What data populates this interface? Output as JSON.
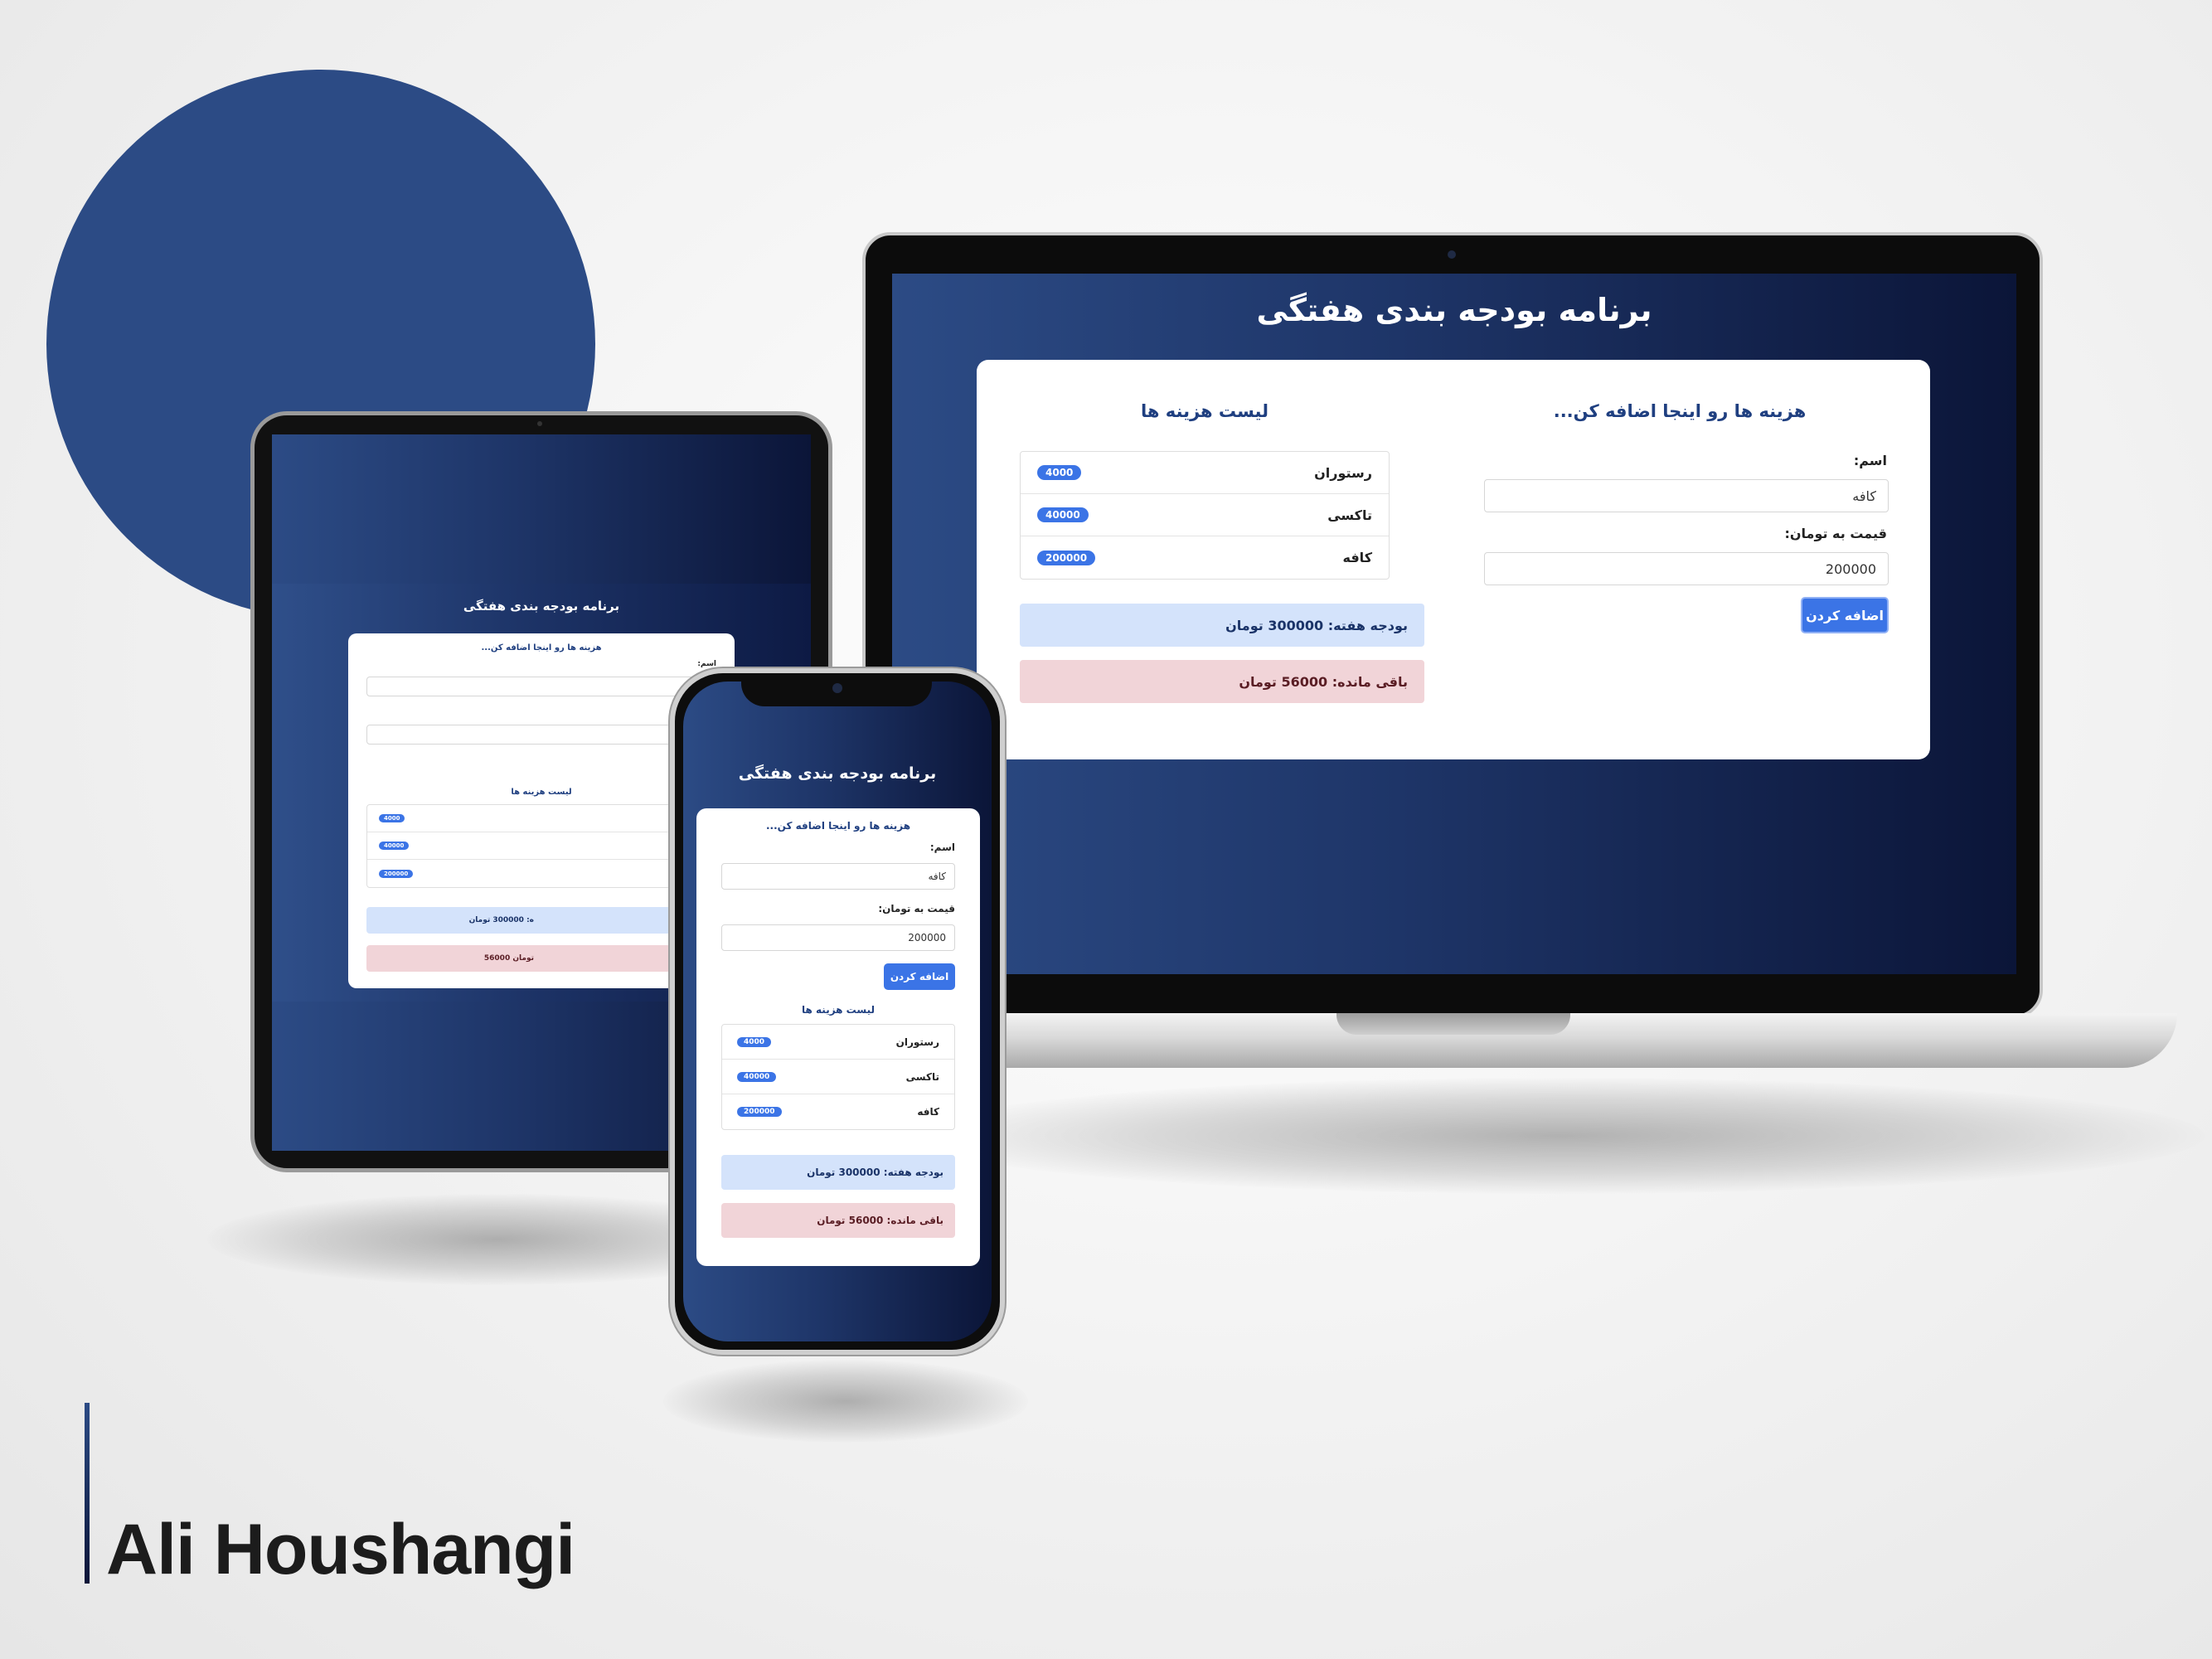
{
  "app": {
    "title": "برنامه بودجه بندی هفتگی",
    "form_title": "هزینه ها رو اینجا اضافه کن...",
    "name_label": "اسم:",
    "name_value": "کافه",
    "price_label": "قیمت به تومان:",
    "price_value": "200000",
    "add_button": "اضافه کردن",
    "list_title": "لیست هزینه ها",
    "expenses": [
      {
        "name": "رستوران",
        "amount": "4000"
      },
      {
        "name": "تاکسی",
        "amount": "40000"
      },
      {
        "name": "کافه",
        "amount": "200000"
      }
    ],
    "budget_text": "بودجه هفته: 300000 تومان",
    "remaining_text": "باقی مانده: 56000 تومان"
  },
  "tablet": {
    "name_label_partial": "اسم:",
    "price_label_partial": "ن:",
    "budget_partial": "ه: 300000 تومان",
    "remaining_partial": "56000 تومان"
  },
  "brand": {
    "name": "Ali Houshangi"
  },
  "colors": {
    "accent": "#3b74e6",
    "navy": "#2c4b85",
    "info_bg": "#d4e3fb",
    "danger_bg": "#f1d4d8"
  }
}
